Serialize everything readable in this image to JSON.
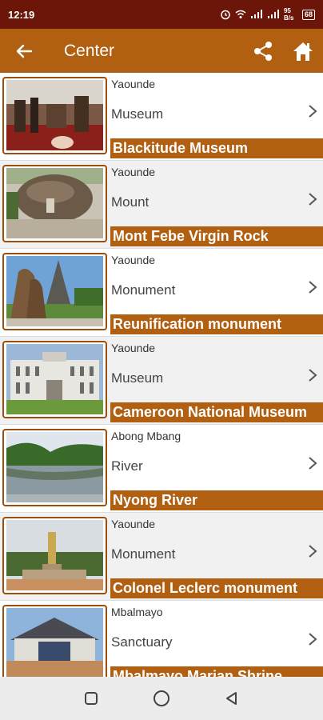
{
  "status_bar": {
    "time": "12:19",
    "network_speed": "95 B/s",
    "battery": "68"
  },
  "app_bar": {
    "title": "Center"
  },
  "places": [
    {
      "city": "Yaounde",
      "category": "Museum",
      "name": "Blackitude Museum"
    },
    {
      "city": "Yaounde",
      "category": "Mount",
      "name": "Mont Febe Virgin Rock"
    },
    {
      "city": "Yaounde",
      "category": "Monument",
      "name": "Reunification monument"
    },
    {
      "city": "Yaounde",
      "category": "Museum",
      "name": "Cameroon National Museum"
    },
    {
      "city": "Abong Mbang",
      "category": "River",
      "name": "Nyong River"
    },
    {
      "city": "Yaounde",
      "category": "Monument",
      "name": "Colonel Leclerc monument"
    },
    {
      "city": "Mbalmayo",
      "category": "Sanctuary",
      "name": "Mbalmayo Marian Shrine"
    }
  ],
  "colors": {
    "status_bar": "#6b1608",
    "app_bar": "#b15f11",
    "name_bar": "#b15f11"
  },
  "icons": {
    "back": "arrow-left-icon",
    "share": "share-icon",
    "home": "home-icon",
    "row_chevron": "chevron-right-icon",
    "nav_recents": "square-icon",
    "nav_home": "circle-icon",
    "nav_back": "triangle-back-icon"
  }
}
